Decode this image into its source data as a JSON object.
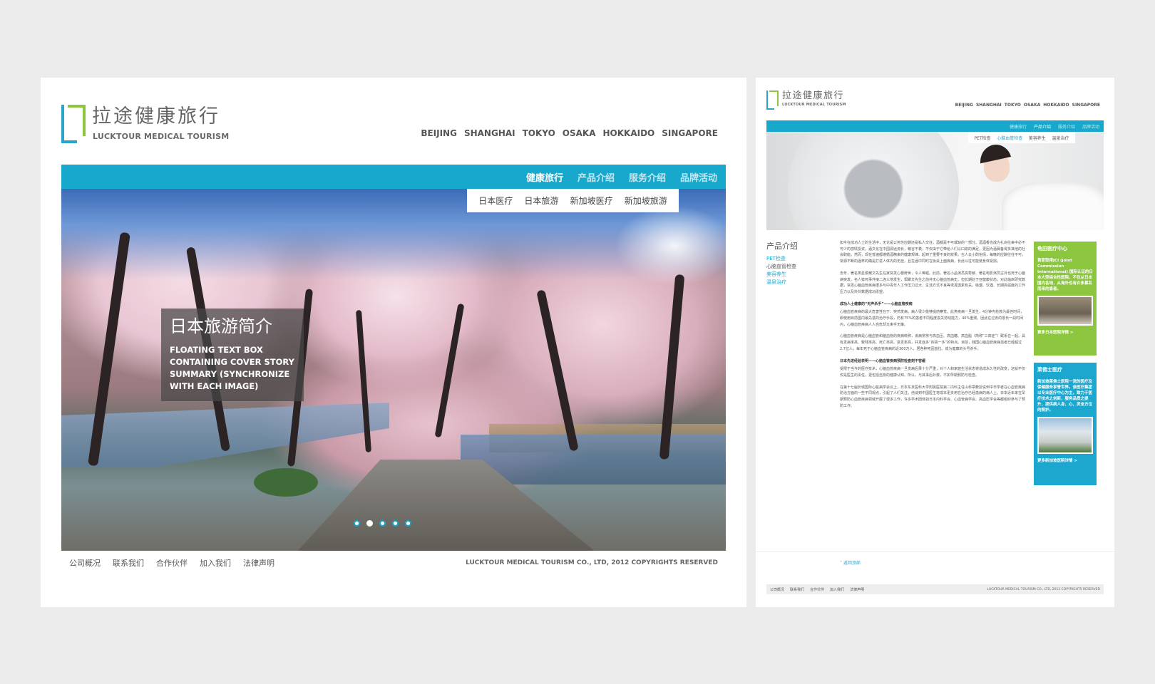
{
  "brand": {
    "name_zh": "拉途健康旅行",
    "name_en": "LUCKTOUR MEDICAL TOURISM",
    "colors": {
      "blue": "#17a8cc",
      "green": "#8cc63f"
    }
  },
  "cities": [
    "BEIJING",
    "SHANGHAI",
    "TOKYO",
    "OSAKA",
    "HOKKAIDO",
    "SINGAPORE"
  ],
  "main_nav": [
    "健康旅行",
    "产品介绍",
    "服务介绍",
    "品牌活动"
  ],
  "home": {
    "submenu": [
      "日本医疗",
      "日本旅游",
      "新加坡医疗",
      "新加坡旅游"
    ],
    "caption_title": "日本旅游简介",
    "caption_body": "FLOATING TEXT BOX CONTAINING COVER STORY SUMMARY (SYNCHRONIZE WITH EACH IMAGE)",
    "slide_count": 5,
    "active_slide": 2
  },
  "footer": {
    "links": [
      "公司概况",
      "联系我们",
      "合作伙伴",
      "加入我们",
      "法律声明"
    ],
    "copyright": "LUCKTOUR MEDICAL TOURISM CO., LTD, 2012 COPYRIGHTS RESERVED"
  },
  "product": {
    "submenu": [
      "PET检查",
      "心脑血管检查",
      "美容养生",
      "温泉治疗"
    ],
    "active_submenu": "心脑血管检查",
    "side_title": "产品介绍",
    "side_nav": [
      "PET检查",
      "心脑血管检查",
      "美容养生",
      "温泉治疗"
    ],
    "article": [
      {
        "heading": "",
        "text": "如今在成功人士的生活中，无论是公务性应酬还是私人交往，酒都是不可或缺的一部分。酒酒香也成为礼尚往来中必不可少的感情投资。酒文化在中国源远流长，粮谷不衰，不仅由于它带给人们以口欲的满足，更因为酒募备得多其他的社会职能。然而，现在普遍都遵循酒精来的健康规律、起到了重要不良的效果。古人云小酌怡情，每晚的应酬往往不可，常源不断的酒杯的确是打进人体内的无症，且在酒中同时在饭桌上面疾病，长此以往可能使身体受损。"
      },
      {
        "heading": "",
        "text": "去年，著名笑星侯耀文先生在家突发心梗辞世，令人唏嘘。此前，著名小品演员高秀敏、著名电影演员古月也死于心脑病突发。名人猝死事件接二连三地发生，惧聚文先生之前并无心脑血管病史。但长期处于亚健康状态，对此临床研究数据，突发心脑血管疾病很多与中青年人工作压力过大、生活方式不良等诱发因素有关。吸烟、饮酒、长期高强度的工作压力以及抖抖数据成功愿望。"
      },
      {
        "heading": "成功人士健康的“无声杀手”——心脑血管疾病",
        "text": "心脑血管疾病的最大危害性在于：突然发病，病人很少能够提前察觉。此类疾病一旦发生，4分钟内抢救为最佳时间，即使用目前国内最先进的治疗手段，仍有75%的患者不同程度丧失劳动能力，40%重残。因此在过去的很长一段时间内，心脑血管疾病人人自危却又束手无策。"
      },
      {
        "heading": "",
        "text": "心脑血管疾病是心脑血管和脑血管的疾病统称，该病常常与高血压、高血糖、高血脂（简称“三高症”）联系在一起。具有发病率高、致残率高、死亡率高、复发率高，并发症多“四高一多”的特点。目前，我国心脑血管疾病患者已经超过2.7亿人，每年死于心脑血管疾病的近300万人，居各种死因首位。成为健康的头号杀手。"
      },
      {
        "heading": "日本先进经验表明——心脑血管疾病预防检查刻不容缓",
        "text": "受限于当今的医疗技术，心脑血管疾病一旦发病后果十分严重，对个人和家庭生活状态将造成永久性的改变，这就不仅仅是医生的责任，更包括自身的健康认知。所以，与其事后补救，不如早期预防与检查。"
      },
      {
        "heading": "",
        "text": "在第十七届长城国际心脏病学会议上，日本东京医科大学附属医院第二内科主任山科章教授说到中日学者在心血管疾病防治方面的一些不同观点，引起了人们关注。他谈到中国医生将成本更多用在治疗已经患病的病人上。日本近年来在早期预防心血管疾病领域开展了很多工作，许多学术团体如日本内科学会、心血管病学会、高血压学会等都组织参与了预防工作。"
      }
    ],
    "back_top": "返回顶部",
    "promo1": {
      "title": "龟田医疗中心",
      "body": "首家取得JCI (Joint Commission International) 国际认证的日本大型综合性医院，不仅从日本国内各地，从海外也有许多慕名而来的患者。",
      "link": "更多日本医院详情 >"
    },
    "promo2": {
      "title": "莱佛士医疗",
      "body": "新加坡莱佛士医院一流的医疗及保健服务享誉世界。该医疗集团以专业医疗中心为主，致力于医疗技术之创新，服务品质之提升，提供病人身、心、灵全方位的照护。",
      "link": "更多新加坡医院详情 >"
    }
  }
}
